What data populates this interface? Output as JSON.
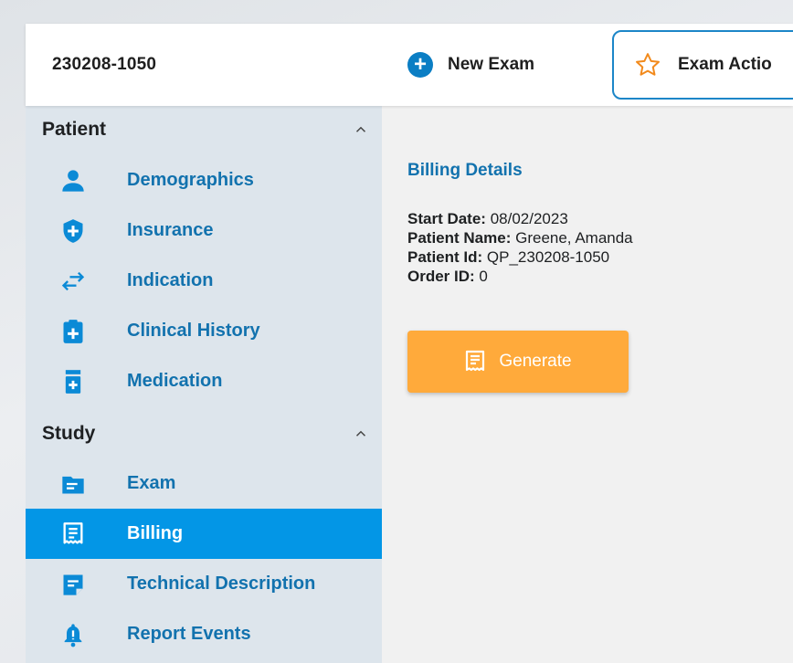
{
  "header": {
    "exam_id": "230208-1050",
    "new_exam_label": "New Exam",
    "exam_actions_label": "Exam Actio"
  },
  "sidebar": {
    "patient_section": {
      "title": "Patient",
      "items": [
        {
          "label": "Demographics",
          "icon": "person-icon"
        },
        {
          "label": "Insurance",
          "icon": "shield-plus-icon"
        },
        {
          "label": "Indication",
          "icon": "swap-arrows-icon"
        },
        {
          "label": "Clinical History",
          "icon": "clipboard-plus-icon"
        },
        {
          "label": "Medication",
          "icon": "pill-bottle-icon"
        }
      ]
    },
    "study_section": {
      "title": "Study",
      "items": [
        {
          "label": "Exam",
          "icon": "folder-icon"
        },
        {
          "label": "Billing",
          "icon": "receipt-icon",
          "active": true
        },
        {
          "label": "Technical Description",
          "icon": "note-icon"
        },
        {
          "label": "Report Events",
          "icon": "bell-icon"
        }
      ]
    }
  },
  "main": {
    "title": "Billing Details",
    "details": [
      {
        "key": "Start Date:",
        "value": "08/02/2023"
      },
      {
        "key": "Patient Name:",
        "value": "Greene, Amanda"
      },
      {
        "key": "Patient Id:",
        "value": "QP_230208-1050"
      },
      {
        "key": "Order ID:",
        "value": "0"
      }
    ],
    "generate_label": "Generate"
  },
  "colors": {
    "primary": "#1272ae",
    "active_bg": "#0396e6",
    "generate_bg": "#ffaa3b",
    "star": "#f28a1c"
  }
}
